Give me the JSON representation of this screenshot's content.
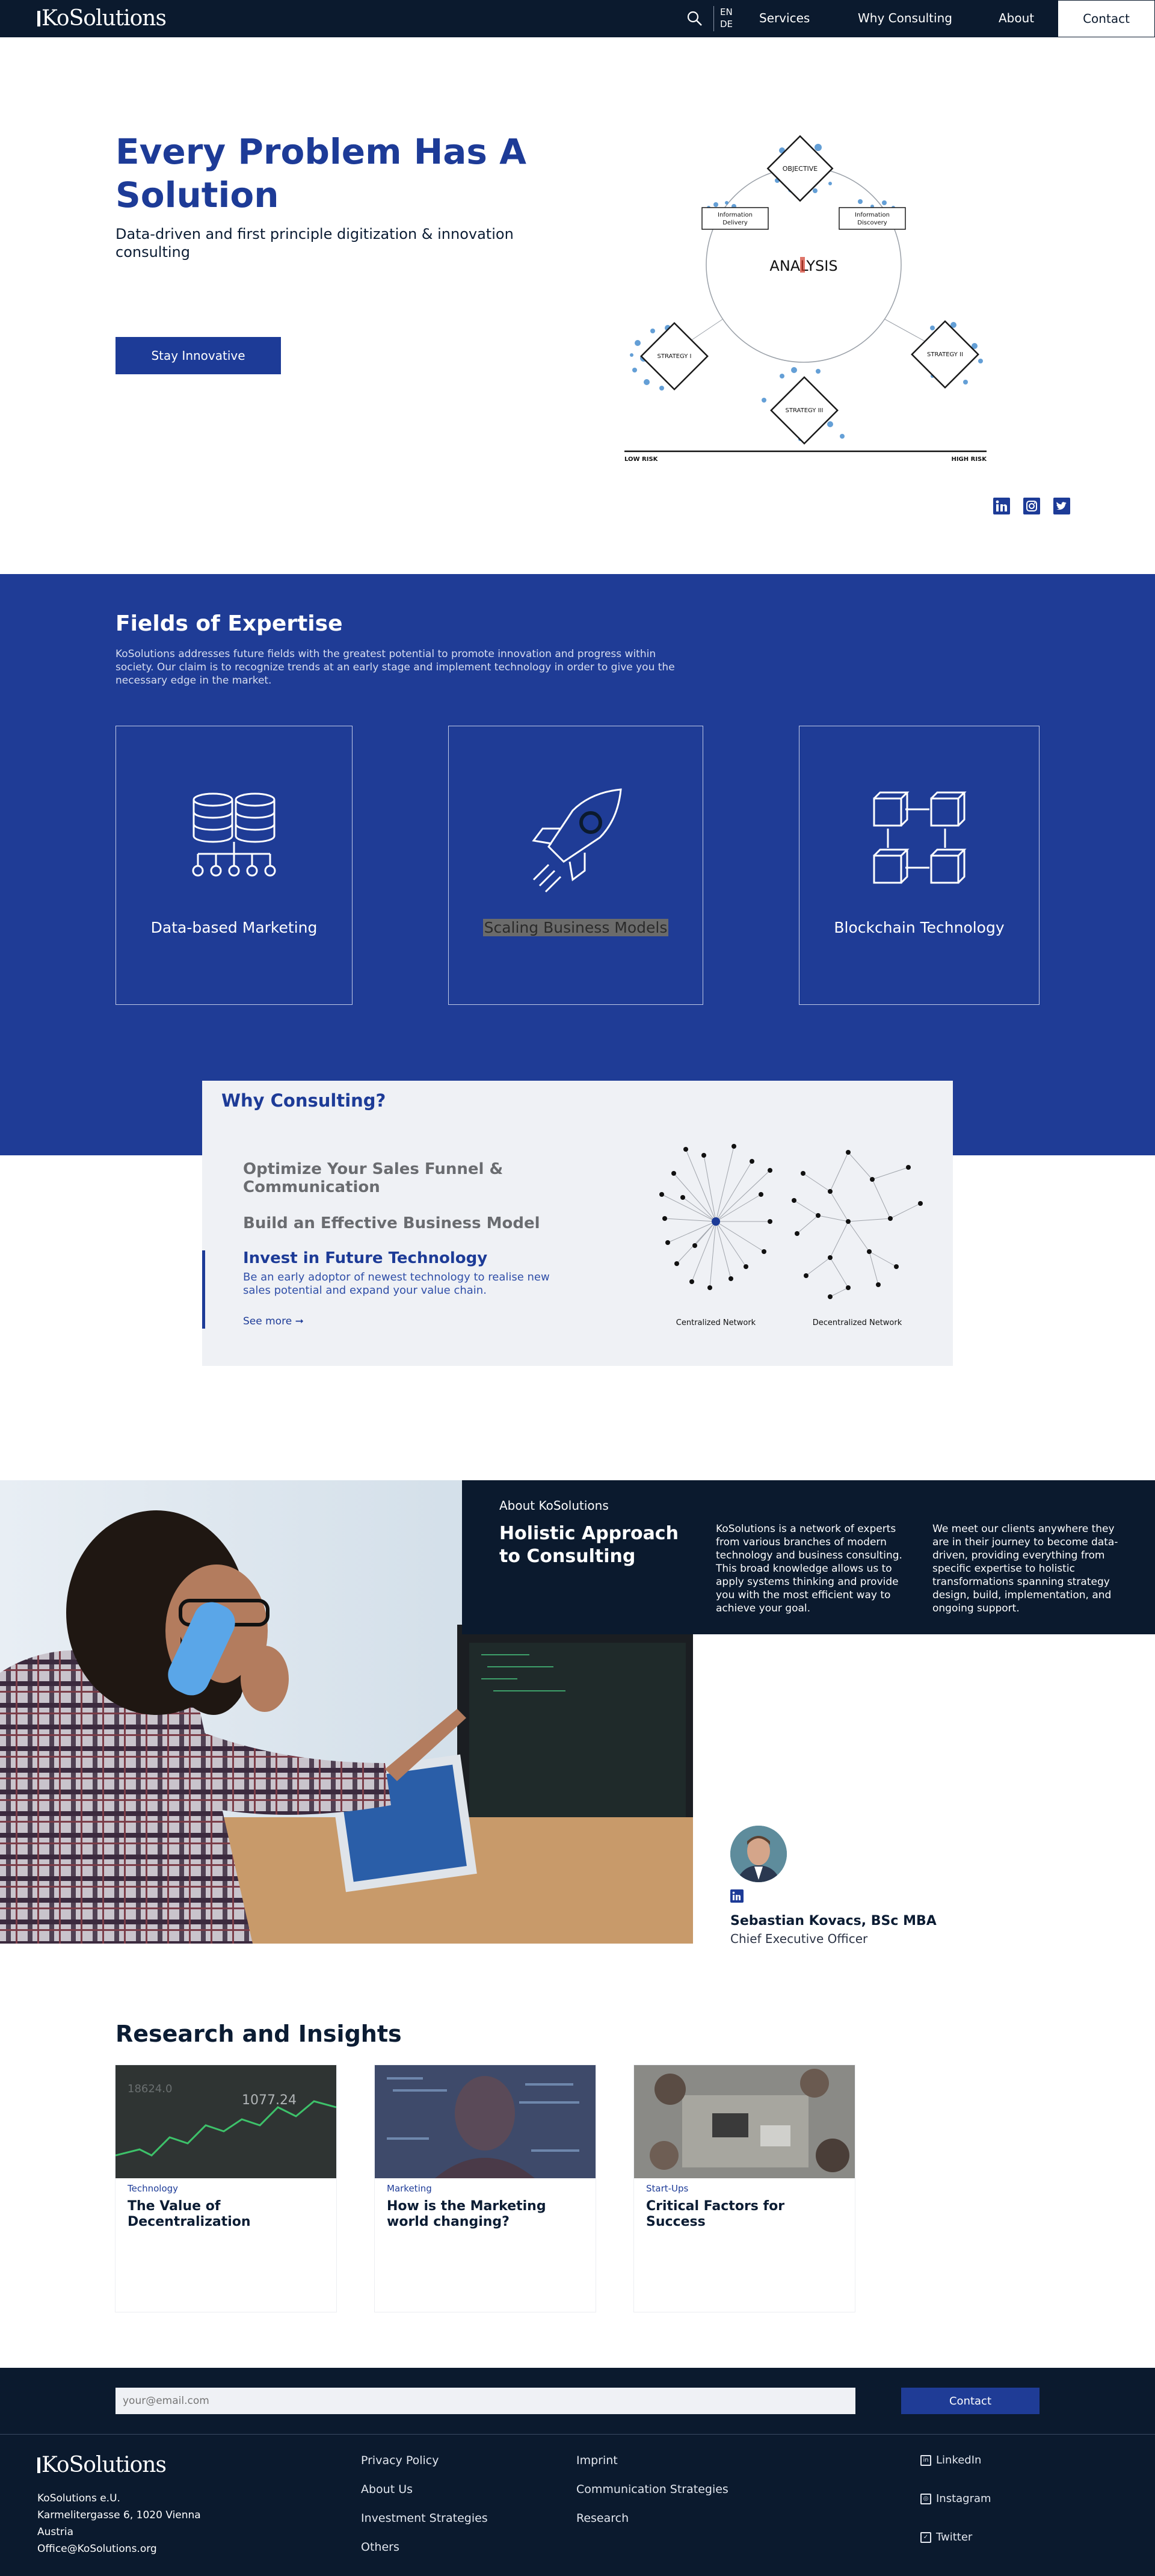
{
  "nav": {
    "logo": "KoSolutions",
    "lang": [
      "EN",
      "DE"
    ],
    "links": [
      "Services",
      "Why Consulting",
      "About"
    ],
    "contact": "Contact"
  },
  "hero": {
    "title": "Every Problem Has A Solution",
    "subtitle": "Data-driven and first principle digitization & innovation consulting",
    "button": "Stay Innovative",
    "diagram": {
      "objective": "OBJECTIVE",
      "info_delivery": "Information Delivery",
      "info_discovery": "Information Discovery",
      "analysis": "ANALYSIS",
      "strategy1": "STRATEGY I",
      "strategy2": "STRATEGY II",
      "strategy3": "STRATEGY III",
      "low_risk": "LOW RISK",
      "high_risk": "HIGH RISK"
    }
  },
  "social_icons": [
    "linkedin-icon",
    "instagram-icon",
    "twitter-icon"
  ],
  "expertise": {
    "title": "Fields of Expertise",
    "description": "KoSolutions addresses future fields with the greatest potential to promote innovation and progress within society. Our claim is to recognize trends at an early stage and implement technology in order to give you the necessary edge in the market.",
    "cards": [
      {
        "label": "Data-based Marketing",
        "icon": "database-icon"
      },
      {
        "label": "Scaling Business Models",
        "icon": "rocket-icon"
      },
      {
        "label": "Blockchain Technology",
        "icon": "blockchain-icon"
      }
    ]
  },
  "why": {
    "title": "Why Consulting?",
    "items": [
      "Optimize Your Sales Funnel & Communication",
      "Build an Effective Business Model",
      "Invest in Future Technology"
    ],
    "active_desc": "Be an early adoptor of newest technology to realise new sales potential and expand your value chain.",
    "see_more": "See more",
    "network_labels": [
      "Centralized Network",
      "Decentralized Network"
    ]
  },
  "about": {
    "label": "About KoSolutions",
    "title": "Holistic Approach to Consulting",
    "col1": "KoSolutions is a network of experts from various branches of modern technology and business consulting. This broad knowledge allows us to apply systems thinking and provide you with the most efficient way to achieve your goal.",
    "col2": "We meet our clients anywhere they are in their journey to become data-driven, providing everything from specific expertise to holistic transformations spanning strategy design, build, implementation, and ongoing support.",
    "ceo_name": "Sebastian Kovacs, BSc MBA",
    "ceo_role": "Chief Executive Officer"
  },
  "research": {
    "title": "Research and Insights",
    "cards": [
      {
        "tag": "Technology",
        "title": "The Value of Decentralization"
      },
      {
        "tag": "Marketing",
        "title": "How is the Marketing world changing?"
      },
      {
        "tag": "Start-Ups",
        "title": "Critical Factors for Success"
      }
    ]
  },
  "footer": {
    "email_placeholder": "your@email.com",
    "contact": "Contact",
    "logo": "KoSolutions",
    "address": [
      "KoSolutions e.U.",
      "Karmelitergasse 6, 1020 Vienna",
      "Austria",
      "Office@KoSolutions.org"
    ],
    "col1": [
      "Privacy Policy",
      "About Us",
      "Investment Strategies",
      "Others"
    ],
    "col2": [
      "Imprint",
      "Communication Strategies",
      "Research"
    ],
    "social": [
      "LinkedIn",
      "Instagram",
      "Twitter"
    ]
  },
  "colors": {
    "brand_blue": "#1f3c96",
    "navy": "#0b1a2e"
  }
}
